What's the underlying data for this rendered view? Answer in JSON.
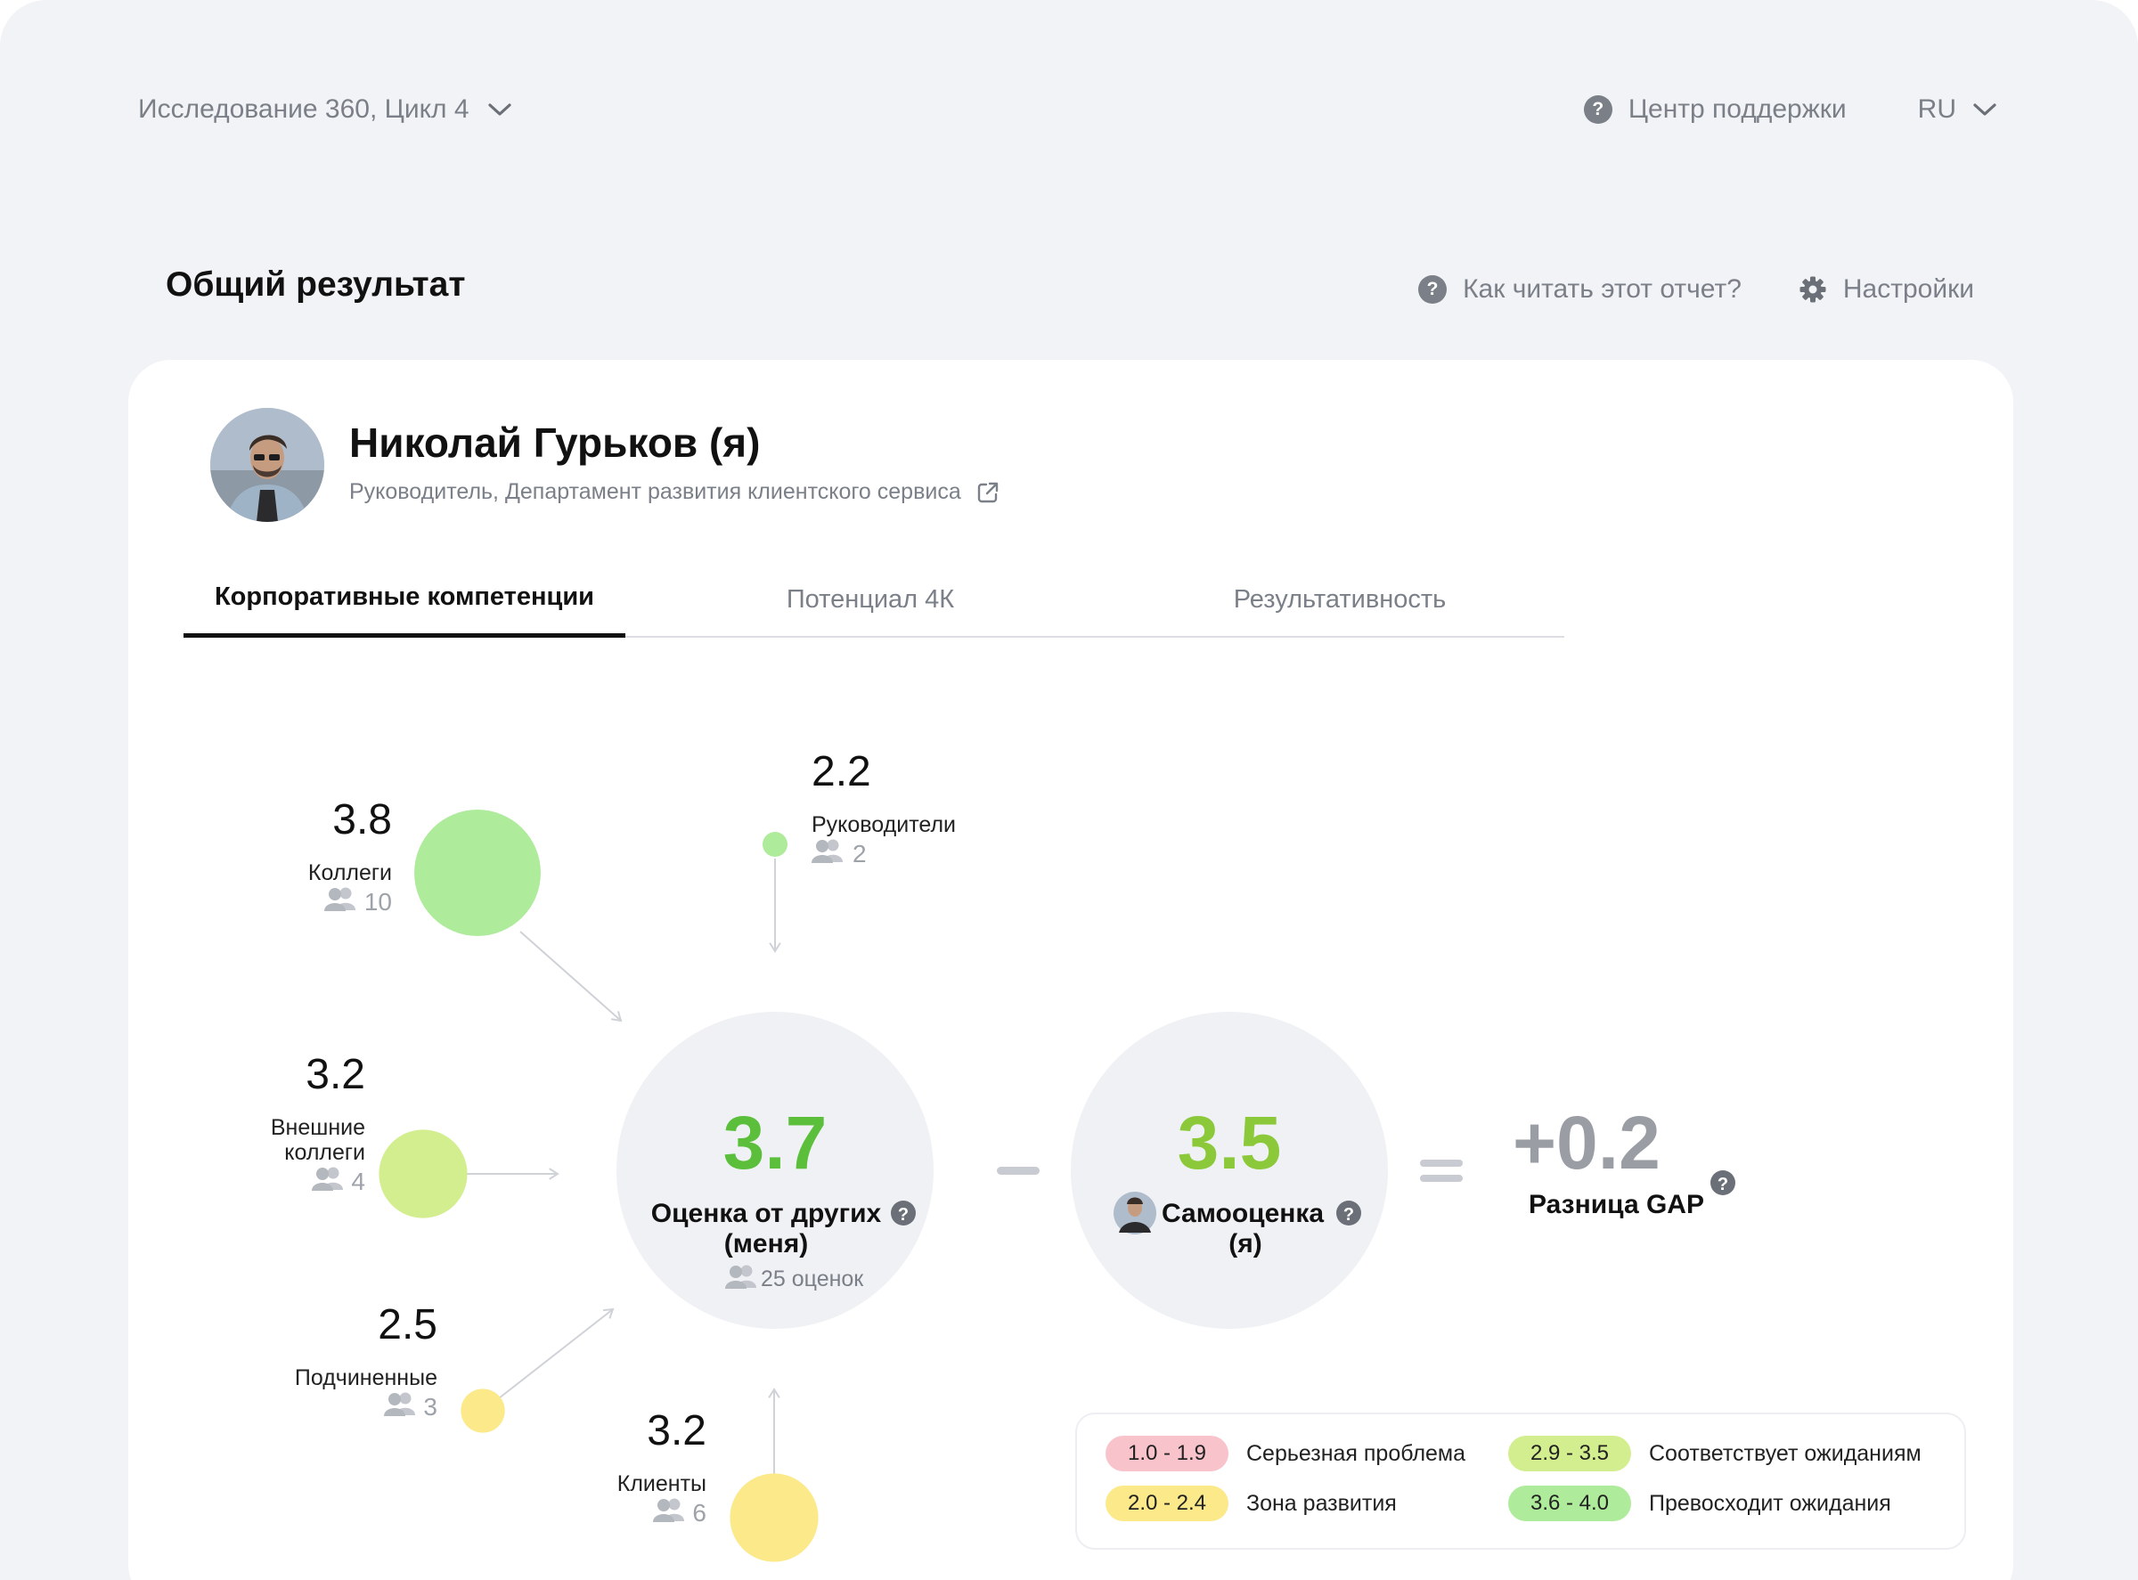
{
  "topbar": {
    "study": "Исследование 360, Цикл 4",
    "support": "Центр поддержки",
    "lang": "RU"
  },
  "title": {
    "text": "Общий результат",
    "howto": "Как читать этот отчет?",
    "settings": "Настройки"
  },
  "person": {
    "name": "Николай Гурьков (я)",
    "role": "Руководитель, Департамент развития клиентского сервиса"
  },
  "tabs": [
    {
      "label": "Корпоративные компетенции",
      "active": true
    },
    {
      "label": "Потенциал 4К",
      "active": false
    },
    {
      "label": "Результативность",
      "active": false
    }
  ],
  "chart_data": {
    "type": "bubble",
    "groups": [
      {
        "name": "Коллеги",
        "lines": [
          "Коллеги"
        ],
        "value": 3.8,
        "respondents": 10,
        "color": "#aeeb9a",
        "anchor": "left"
      },
      {
        "name": "Руководители",
        "lines": [
          "Руководители"
        ],
        "value": 2.2,
        "respondents": 2,
        "color": "#aeeb9a",
        "anchor": "top"
      },
      {
        "name": "Внешние коллеги",
        "lines": [
          "Внешние",
          "коллеги"
        ],
        "value": 3.2,
        "respondents": 4,
        "color": "#d3ee8e",
        "anchor": "left"
      },
      {
        "name": "Подчиненные",
        "lines": [
          "Подчиненные"
        ],
        "value": 2.5,
        "respondents": 3,
        "color": "#fbe98a",
        "anchor": "left"
      },
      {
        "name": "Клиенты",
        "lines": [
          "Клиенты"
        ],
        "value": 3.2,
        "respondents": 6,
        "color": "#fbe98a",
        "anchor": "bottom"
      }
    ],
    "others": {
      "value": "3.7",
      "label_lines": [
        "Оценка от других",
        "(меня)"
      ],
      "count_text": "25 оценок",
      "color": "#5bbf3c"
    },
    "self": {
      "value": "3.5",
      "label_lines": [
        "Самооценка",
        "(я)"
      ],
      "color": "#8bc93a"
    },
    "gap": {
      "value": "+0.2",
      "label": "Разница GAP",
      "color": "#9a9da4"
    },
    "legend": [
      {
        "range": "1.0 - 1.9",
        "label": "Серьезная проблема",
        "color": "#f9c3cb"
      },
      {
        "range": "2.0 - 2.4",
        "label": "Зона развития",
        "color": "#fbe98a"
      },
      {
        "range": "2.9 - 3.5",
        "label": "Соответствует ожиданиям",
        "color": "#d3ee8e"
      },
      {
        "range": "3.6 - 4.0",
        "label": "Превосходит ожидания",
        "color": "#aeeb9a"
      }
    ]
  }
}
